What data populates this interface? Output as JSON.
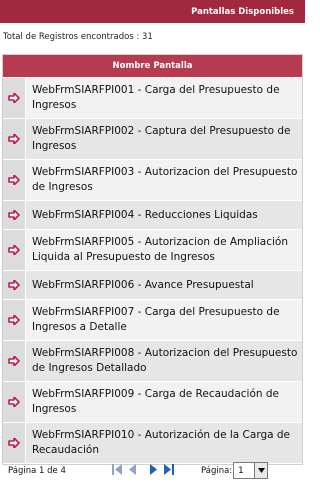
{
  "topbar": {
    "title": "Pantallas Disponibles"
  },
  "summary": {
    "total_text": "Total de Registros encontrados : 31"
  },
  "grid": {
    "header": "Nombre Pantalla",
    "rows": [
      {
        "label": "WebFrmSIARFPI001 - Carga del Presupuesto de Ingresos"
      },
      {
        "label": "WebFrmSIARFPI002 - Captura del Presupuesto de Ingresos"
      },
      {
        "label": "WebFrmSIARFPI003 - Autorizacion del Presupuesto de Ingresos"
      },
      {
        "label": "WebFrmSIARFPI004 - Reducciones Liquidas"
      },
      {
        "label": "WebFrmSIARFPI005 - Autorizacion de Ampliación Liquida al Presupuesto de Ingresos"
      },
      {
        "label": "WebFrmSIARFPI006 - Avance Presupuestal"
      },
      {
        "label": "WebFrmSIARFPI007 - Carga del Presupuesto de Ingresos a Detalle"
      },
      {
        "label": "WebFrmSIARFPI008 - Autorizacion del Presupuesto de Ingresos Detallado"
      },
      {
        "label": "WebFrmSIARFPI009 - Carga de Recaudación de Ingresos"
      },
      {
        "label": "WebFrmSIARFPI010 - Autorización de la Carga de Recaudación"
      }
    ]
  },
  "footer": {
    "page_info": "Página 1 de 4",
    "page_label": "Página:",
    "page_value": "1"
  },
  "colors": {
    "topbar": "#a2283f",
    "header": "#b63a50",
    "arrow": "#c0185a",
    "pager_disabled": "#8fa3c9",
    "pager_enabled": "#1f5fb8"
  }
}
